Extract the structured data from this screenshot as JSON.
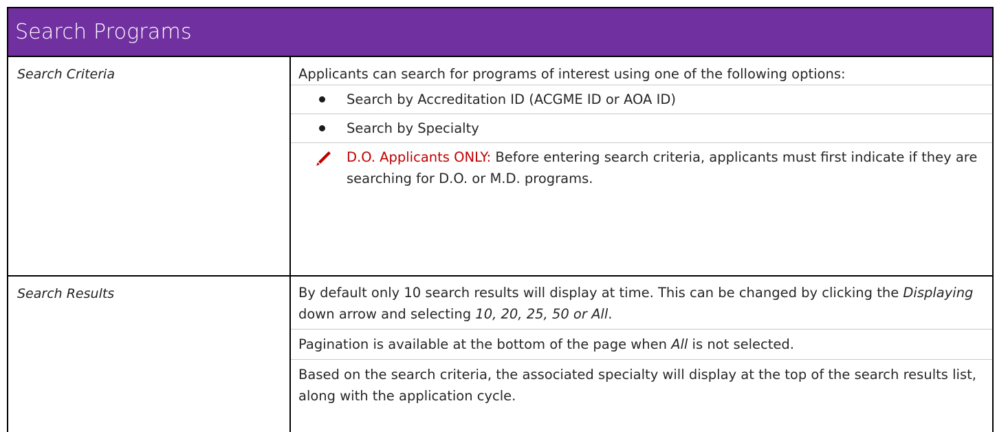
{
  "header": {
    "title": "Search Programs"
  },
  "rows": [
    {
      "label": "Search Criteria",
      "intro": "Applicants can search for programs of interest using one of the following options:",
      "bullets": [
        "Search by Accreditation ID (ACGME ID or AOA ID)",
        "Search by Specialty"
      ],
      "note": {
        "icon": "pencil-icon",
        "label": "D.O. Applicants ONLY:",
        "text": " Before entering search criteria, applicants must first indicate if they are searching for D.O. or M.D. programs."
      }
    },
    {
      "label": "Search Results",
      "p1_a": "By default only 10 search results will display at time. This can be changed by clicking the ",
      "p1_em1": "Displaying",
      "p1_b": " down arrow and selecting ",
      "p1_em2": "10, 20, 25, 50 or All",
      "p1_c": ".",
      "p2_a": "Pagination is available at the bottom of the page when ",
      "p2_em": "All",
      "p2_b": " is not selected.",
      "p3": "Based on the search criteria, the associated specialty will display at the top of the search results list, along with the application cycle."
    }
  ],
  "colors": {
    "header_bg": "#7030a0",
    "note_red": "#c00000"
  }
}
